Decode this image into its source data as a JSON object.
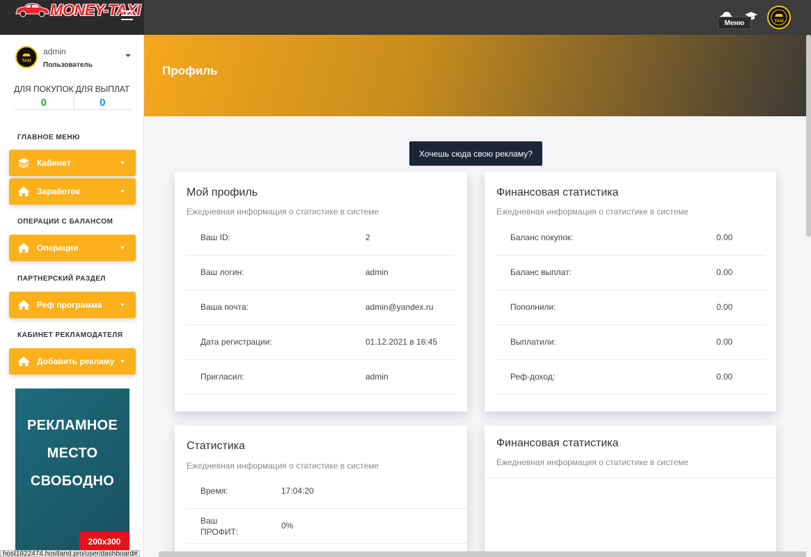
{
  "header": {
    "logo_text": "MONEY-TAXI",
    "tooltip": "Меню"
  },
  "sidebar": {
    "user": {
      "name": "admin",
      "role": "Пользователь"
    },
    "balances": [
      {
        "label": "ДЛЯ ПОКУПОК",
        "value": "0",
        "color": "#2da42d"
      },
      {
        "label": "ДЛЯ ВЫПЛАТ",
        "value": "0",
        "color": "#1a8be0"
      }
    ],
    "sections": {
      "main": "ГЛАВНОЕ МЕНЮ",
      "balance_ops": "ОПЕРАЦИИ С БАЛАНСОМ",
      "partner": "ПАРТНЕРСКИЙ РАЗДЕЛ",
      "advertiser": "КАБИНЕТ РЕКЛАМОДАТЕЛЯ"
    },
    "items": [
      {
        "label": "Кабинет",
        "icon": "layers-icon"
      },
      {
        "label": "Заработок",
        "icon": "home-icon"
      },
      {
        "label": "Операции",
        "icon": "home-icon"
      },
      {
        "label": "Реф программа",
        "icon": "home-icon"
      },
      {
        "label": "Добавить рекламу",
        "icon": "home-icon"
      }
    ],
    "ad_banner": {
      "line1": "РЕКЛАМНОЕ",
      "line2": "МЕСТО",
      "line3": "СВОБОДНО",
      "size": "200x300"
    }
  },
  "page": {
    "title": "Профиль",
    "ad_cta": "Хочешь сюда свою рекламу?"
  },
  "profile_card": {
    "title": "Мой профиль",
    "subtitle": "Ежедневная информация о статистике в системе",
    "rows": [
      {
        "label": "Ваш ID:",
        "value": "2"
      },
      {
        "label": "Ваш логин:",
        "value": "admin"
      },
      {
        "label": "Ваша почта:",
        "value": "admin@yandex.ru"
      },
      {
        "label": "Дата регистрации:",
        "value": "01.12.2021 в 16:45"
      },
      {
        "label": "Пригласил:",
        "value": "admin"
      }
    ]
  },
  "finance_card": {
    "title": "Финансовая статистика",
    "subtitle": "Ежедневная информация о статистике в системе",
    "rows": [
      {
        "label": "Баланс покупок:",
        "value": "0.00"
      },
      {
        "label": "Баланс выплат:",
        "value": "0.00"
      },
      {
        "label": "Пополнили:",
        "value": "0.00"
      },
      {
        "label": "Выплатили:",
        "value": "0.00"
      },
      {
        "label": "Реф-доход:",
        "value": "0.00"
      }
    ]
  },
  "stats_card": {
    "title": "Статистика",
    "subtitle": "Ежедневная информация о статистике в системе",
    "rows": [
      {
        "label": "Время:",
        "value": "17:04:20"
      },
      {
        "label_line1": "Ваш",
        "label_line2": "ПРОФИТ:",
        "value": "0%"
      }
    ]
  },
  "finance_card_2": {
    "title": "Финансовая статистика",
    "subtitle": "Ежедневная информация о статистике в системе"
  },
  "status_bar": {
    "url": "host1822474.hostland.pro/user/dashboard#"
  }
}
